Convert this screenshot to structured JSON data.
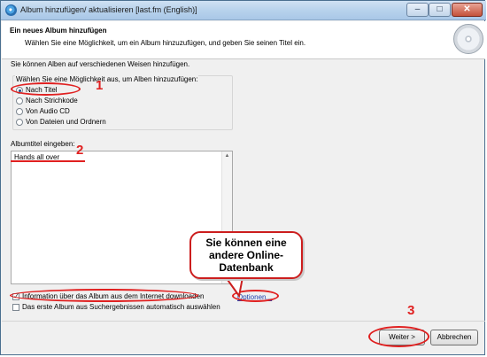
{
  "window": {
    "title": "Album hinzufügen/ aktualisieren [last.fm (English)]",
    "controls": {
      "minimize": "–",
      "maximize": "□",
      "close": "✕"
    }
  },
  "header": {
    "title": "Ein neues Album hinzufügen",
    "subtitle": "Wählen Sie eine Möglichkeit, um ein Album hinzuzufügen, und geben Sie seinen Titel ein."
  },
  "intro": "Sie können Alben auf verschiedenen Weisen hinzufügen.",
  "method_group": {
    "label": "Wählen Sie eine Möglichkeit aus, um Alben hinzuzufügen:",
    "options": [
      {
        "label": "Nach Titel",
        "selected": true
      },
      {
        "label": "Nach Strichkode",
        "selected": false
      },
      {
        "label": "Von Audio CD",
        "selected": false
      },
      {
        "label": "Von Dateien und Ordnern",
        "selected": false
      }
    ]
  },
  "album_title": {
    "label": "Albumtitel eingeben:",
    "value": "Hands all over"
  },
  "checkboxes": [
    {
      "label": "Information über das Album aus dem Internet downloaden",
      "checked": true
    },
    {
      "label": "Das erste Album aus Suchergebnissen automatisch auswählen",
      "checked": false
    }
  ],
  "options_link": "Optionen...",
  "buttons": {
    "next": "Weiter >",
    "cancel": "Abbrechen"
  },
  "annotations": {
    "step1": "1",
    "step2": "2",
    "step3": "3",
    "bubble_text": "Sie können eine andere Online-Datenbank",
    "color": "#e02020"
  }
}
